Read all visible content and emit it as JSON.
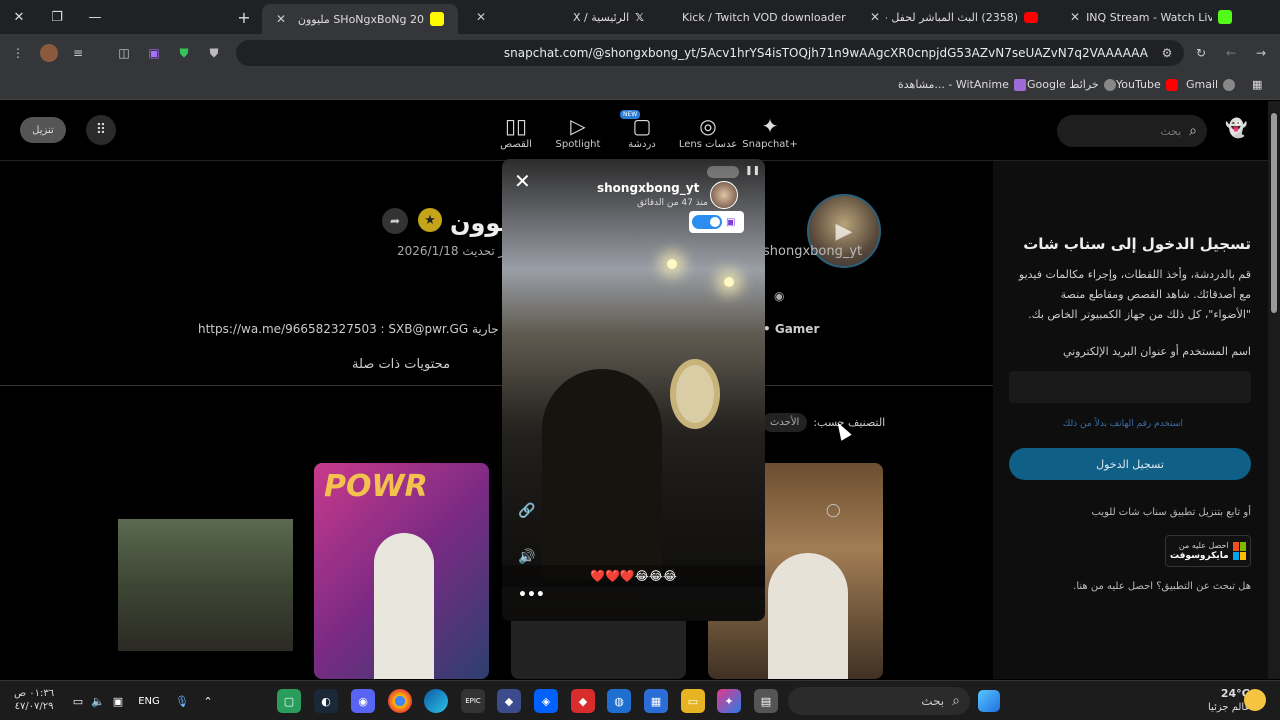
{
  "browser": {
    "tabs": [
      {
        "title": "INQ Stream - Watch Live on Kic",
        "favicon_color": "#53fc18"
      },
      {
        "title": "(2358) البث المباشر لحفل جوي او",
        "favicon_color": "#ff0000"
      },
      {
        "title": "Kick / Twitch VOD downloader",
        "favicon_color": "#24d800"
      },
      {
        "title": "X / الرئيسية",
        "favicon_color": "#ffffff"
      },
      {
        "title": "SHoNgxBoNg 20 مليوون 🐐",
        "favicon_color": "#fffc00"
      }
    ],
    "new_tab": "+",
    "url": "snapchat.com/@shongxbong_yt/5Acv1hrYS4isTOQjh71n9wAAgcXR0cnpjdG53AZvN7seUAZvN7q2VAAAAAA",
    "bookmarks": [
      "Gmail",
      "YouTube",
      "Google خرائط",
      "مشاهدة... - WitAnime"
    ]
  },
  "snapchat": {
    "download_label": "تنزيل",
    "nav": [
      {
        "label": "Snapchat+",
        "icon": "✦"
      },
      {
        "label": "Lens عدسات",
        "icon": "◎"
      },
      {
        "label": "دردشة",
        "icon": "▢",
        "badge": "NEW"
      },
      {
        "label": "Spotlight",
        "icon": "▷"
      },
      {
        "label": "القصص",
        "icon": "▯▯"
      }
    ],
    "search_placeholder": "بحث",
    "profile": {
      "name": "20 مليوون",
      "handle": "shongxbong_yt",
      "updated": "آخر تحديث 2026/1/18",
      "bio_left": "https://wa.me/966582327503 : SXB@pwr.GG جارية",
      "bio_right": "• Gamer",
      "related_tab": "محتويات ذات صلة",
      "sort_label": "التصنيف حسب:",
      "sort_value": "الأحدث"
    },
    "story": {
      "username": "shongxbong_yt",
      "time_ago": "منذ 47 من الدقائق",
      "caption": "❤️❤️❤️😂😂😂",
      "twitch_tag": "Twitch"
    },
    "login": {
      "title": "تسجيل الدخول إلى سناب شات",
      "description": "قم بالدردشة، وأخذ اللقطات، وإجراء مكالمات فيديو مع أصدقائك. شاهد القصص ومقاطع منصة \"الأضواء\"، كل ذلك من جهاز الكمبيوتر الخاص بك.",
      "field_label": "اسم المستخدم أو عنوان البريد الإلكتروني",
      "phone_link": "استخدم رقم الهاتف بدلاً من ذلك",
      "button": "تسجيل الدخول",
      "follow_text": "أو تابع بتنزيل تطبيق سناب شات للويب",
      "ms_small": "احصل عليه من",
      "ms_big": "مايكروسوفت",
      "question": "هل تبحث عن التطبيق؟ احصل عليه من هنا."
    }
  },
  "taskbar": {
    "search": "بحث",
    "lang": "ENG",
    "time": "٠١:٣٦ ص",
    "date": "٤٧/٠٧/٢٩",
    "temp": "24°C",
    "weather": "غالم جزئيا"
  },
  "colors": {
    "login_button": "#0f5f86",
    "gold_badge": "#c5a41a"
  }
}
